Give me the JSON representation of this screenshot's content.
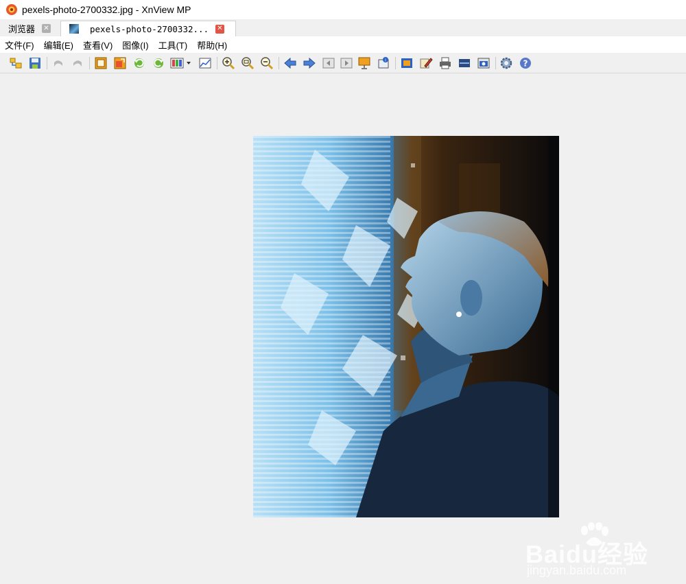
{
  "window": {
    "title": "pexels-photo-2700332.jpg - XnView MP"
  },
  "tabs": [
    {
      "label": "浏览器",
      "active": false
    },
    {
      "label": "pexels-photo-2700332...",
      "active": true
    }
  ],
  "menu": [
    "文件(F)",
    "编辑(E)",
    "查看(V)",
    "图像(I)",
    "工具(T)",
    "帮助(H)"
  ],
  "toolbar": {
    "icons": [
      "open-browser-icon",
      "save-icon",
      "undo-icon",
      "redo-icon",
      "crop-icon",
      "resize-icon",
      "rotate-left-icon",
      "rotate-right-icon",
      "color-adjust-icon",
      "levels-icon",
      "zoom-in-icon",
      "zoom-fit-icon",
      "zoom-out-icon",
      "previous-icon",
      "next-icon",
      "first-icon",
      "last-icon",
      "slideshow-icon",
      "properties-icon",
      "fullscreen-icon",
      "edit-icon",
      "print-icon",
      "scanner-icon",
      "capture-icon",
      "settings-icon",
      "help-icon"
    ]
  },
  "watermark": {
    "brand": "Baidu经验",
    "url": "jingyan.baidu.com"
  },
  "colors": {
    "accent": "#e25545",
    "photo_tint": "#6aaee0",
    "help": "#5a78c8"
  }
}
